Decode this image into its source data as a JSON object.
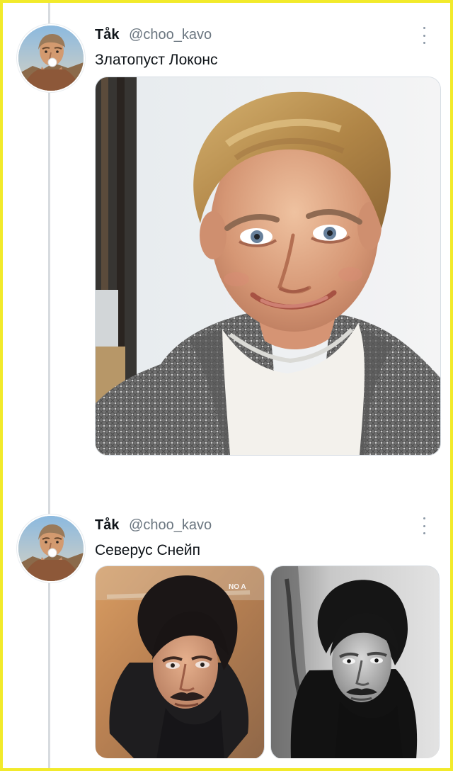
{
  "thread": {
    "tweets": [
      {
        "author": {
          "name": "Tåk",
          "handle": "@choo_kavo"
        },
        "text": "Златопуст Локонс"
      },
      {
        "author": {
          "name": "Tåk",
          "handle": "@choo_kavo"
        },
        "text": "Северус Снейп",
        "media_overlay_text": "NO A"
      }
    ]
  },
  "icons": {
    "more": "more-vertical-icon"
  },
  "colors": {
    "frame_border": "#f2ea2b",
    "thread_line": "#d7dbdf",
    "muted_text": "#6b7680"
  }
}
